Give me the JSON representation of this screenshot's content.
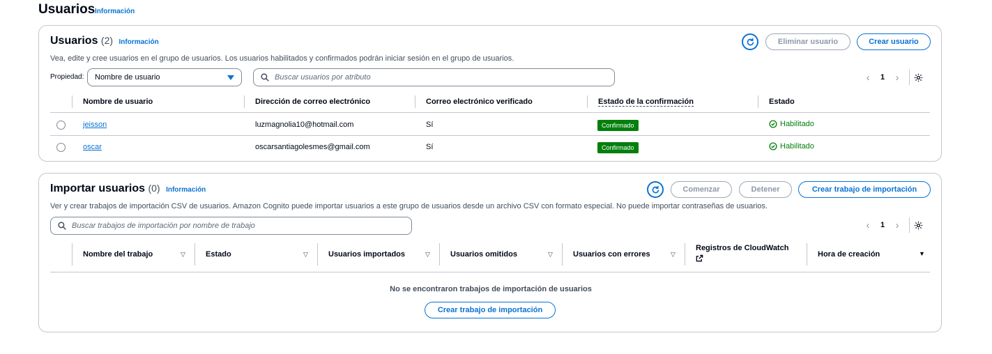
{
  "page": {
    "title": "Usuarios",
    "info": "Información"
  },
  "users_panel": {
    "title": "Usuarios",
    "count": "(2)",
    "info": "Información",
    "description": "Vea, edite y cree usuarios en el grupo de usuarios. Los usuarios habilitados y confirmados podrán iniciar sesión en el grupo de usuarios.",
    "delete_button": "Eliminar usuario",
    "create_button": "Crear usuario",
    "property_label": "Propiedad:",
    "property_value": "Nombre de usuario",
    "search_placeholder": "Buscar usuarios por atributo",
    "page": "1",
    "columns": [
      "Nombre de usuario",
      "Dirección de correo electrónico",
      "Correo electrónico verificado",
      "Estado de la confirmación",
      "Estado"
    ],
    "rows": [
      {
        "username": "jeisson",
        "email": "luzmagnolia10@hotmail.com",
        "verified": "Sí",
        "confirmation": "Confirmado",
        "status": "Habilitado"
      },
      {
        "username": "oscar",
        "email": "oscarsantiagolesmes@gmail.com",
        "verified": "Sí",
        "confirmation": "Confirmado",
        "status": "Habilitado"
      }
    ]
  },
  "import_panel": {
    "title": "Importar usuarios",
    "count": "(0)",
    "info": "Información",
    "description": "Ver y crear trabajos de importación CSV de usuarios. Amazon Cognito puede importar usuarios a este grupo de usuarios desde un archivo CSV con formato especial. No puede importar contraseñas de usuarios.",
    "start_button": "Comenzar",
    "stop_button": "Detener",
    "create_button": "Crear trabajo de importación",
    "search_placeholder": "Buscar trabajos de importación por nombre de trabajo",
    "page": "1",
    "columns": [
      "Nombre del trabajo",
      "Estado",
      "Usuarios importados",
      "Usuarios omitidos",
      "Usuarios con errores",
      "Registros de CloudWatch",
      "Hora de creación"
    ],
    "empty_message": "No se encontraron trabajos de importación de usuarios",
    "empty_create_button": "Crear trabajo de importación"
  },
  "colors": {
    "accent": "#0972d3",
    "success": "#037f0c",
    "border": "#c6c6cd",
    "disabled": "#8d99a8"
  },
  "icons": [
    "refresh-icon",
    "search-icon",
    "caret-down-icon",
    "chevron-left-icon",
    "chevron-right-icon",
    "gear-icon",
    "check-circle-icon",
    "external-link-icon",
    "sort-icon"
  ]
}
